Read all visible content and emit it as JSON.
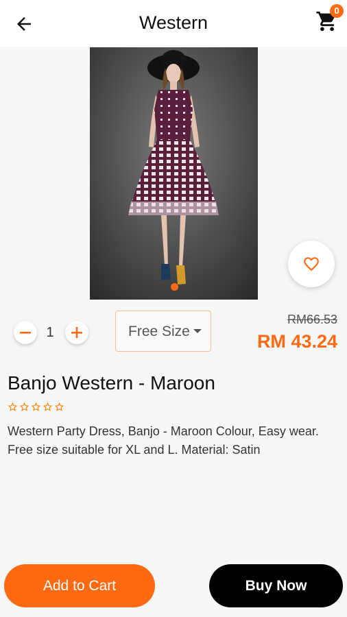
{
  "header": {
    "title": "Western",
    "cart_count": "0"
  },
  "product": {
    "name": "Banjo Western - Maroon",
    "description": "Western Party Dress, Banjo - Maroon Colour, Easy wear. Free size suitable for XL and L. Material: Satin",
    "old_price": "RM66.53",
    "price": "RM 43.24",
    "rating": {
      "value": 0,
      "max": 5
    },
    "image_count": 1,
    "current_image": 1
  },
  "quantity": {
    "value": "1"
  },
  "size": {
    "selected": "Free Size"
  },
  "actions": {
    "add_to_cart": "Add to Cart",
    "buy_now": "Buy Now"
  },
  "colors": {
    "accent": "#ff6a13",
    "buy_button": "#000000"
  },
  "icons": [
    "back-arrow-icon",
    "cart-icon",
    "heart-icon",
    "minus-icon",
    "plus-icon",
    "dropdown-arrow-icon",
    "star-outline-icon"
  ]
}
